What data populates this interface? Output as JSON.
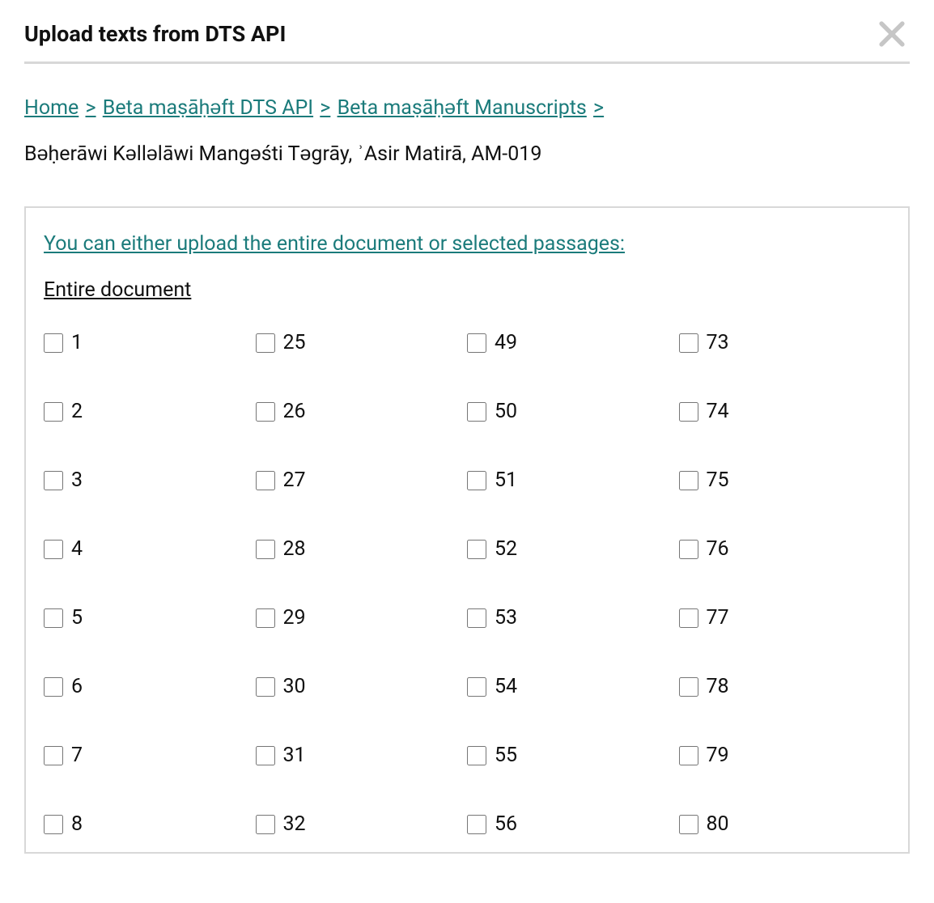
{
  "header": {
    "title": "Upload texts from DTS API"
  },
  "breadcrumb": {
    "items": [
      {
        "label": "Home"
      },
      {
        "label": "Beta maṣāḥǝft DTS API"
      },
      {
        "label": "Beta maṣāḥǝft Manuscripts"
      }
    ],
    "sep": ">"
  },
  "doc_title": "Bǝḥerāwi Kǝllǝlāwi Mangǝśti Tǝgrāy, ʾAsir Matirā, AM-019",
  "panel": {
    "legend": "You can either upload the entire document or selected passages:",
    "entire_doc_label": "Entire document",
    "columns": [
      [
        "1",
        "2",
        "3",
        "4",
        "5",
        "6",
        "7",
        "8"
      ],
      [
        "25",
        "26",
        "27",
        "28",
        "29",
        "30",
        "31",
        "32"
      ],
      [
        "49",
        "50",
        "51",
        "52",
        "53",
        "54",
        "55",
        "56"
      ],
      [
        "73",
        "74",
        "75",
        "76",
        "77",
        "78",
        "79",
        "80"
      ]
    ]
  }
}
